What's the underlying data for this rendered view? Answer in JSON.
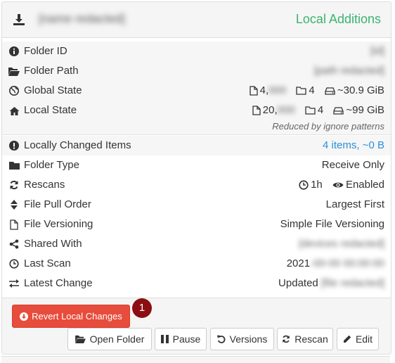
{
  "header": {
    "folder_name": "[name redacted]",
    "status": "Local Additions"
  },
  "rows": {
    "folder_id": {
      "label": "Folder ID",
      "value": "[id]"
    },
    "folder_path": {
      "label": "Folder Path",
      "value": "[path redacted]"
    },
    "global_state": {
      "label": "Global State",
      "files": "4,",
      "files_hidden": "000",
      "dirs": "4",
      "size": "~30.9 GiB"
    },
    "local_state": {
      "label": "Local State",
      "files": "20,",
      "files_hidden": "000",
      "dirs": "4",
      "size": "~99 GiB",
      "note": "Reduced by ignore patterns"
    },
    "locally_changed": {
      "label": "Locally Changed Items",
      "value": "4 items, ~0 B"
    },
    "folder_type": {
      "label": "Folder Type",
      "value": "Receive Only"
    },
    "rescans": {
      "label": "Rescans",
      "interval": "1h",
      "watch": "Enabled"
    },
    "pull_order": {
      "label": "File Pull Order",
      "value": "Largest First"
    },
    "versioning": {
      "label": "File Versioning",
      "value": "Simple File Versioning"
    },
    "shared_with": {
      "label": "Shared With",
      "value": "[devices redacted]"
    },
    "last_scan": {
      "label": "Last Scan",
      "value": "2021",
      "value_hidden": "-00-00 00:00:00"
    },
    "latest_change": {
      "label": "Latest Change",
      "value": "Updated",
      "value_hidden": "[file redacted]"
    }
  },
  "footer": {
    "revert_label": "Revert Local Changes",
    "badge": "1",
    "buttons": {
      "open_folder": "Open Folder",
      "pause": "Pause",
      "versions": "Versions",
      "rescan": "Rescan",
      "edit": "Edit"
    }
  },
  "colors": {
    "status_green": "#3cb371",
    "link_blue": "#2a91d8",
    "danger_red": "#e74c3c",
    "badge_red": "#8b0f12"
  },
  "icons": [
    "download-icon",
    "info-circle-icon",
    "folder-open-icon",
    "globe-icon",
    "home-icon",
    "file-icon",
    "folder-icon",
    "hdd-icon",
    "exclamation-circle-icon",
    "folder-solid-icon",
    "refresh-icon",
    "clock-icon",
    "eye-icon",
    "sort-icon",
    "file-outline-icon",
    "share-icon",
    "exchange-icon",
    "pause-icon",
    "undo-icon",
    "pencil-icon"
  ]
}
